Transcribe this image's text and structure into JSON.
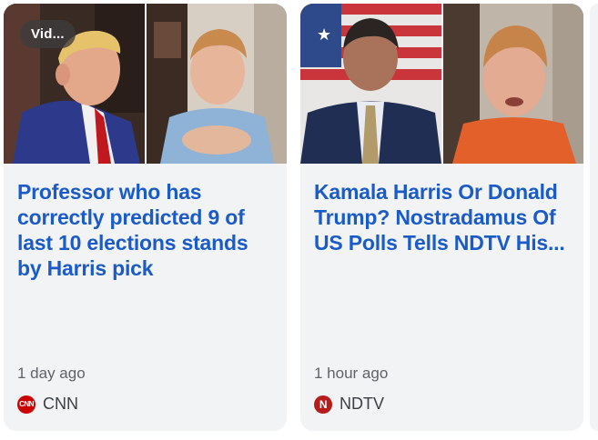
{
  "cards": [
    {
      "badge": "Vid...",
      "title": "Professor who has correctly predicted 9 of last 10 elections stands by Harris pick",
      "time": "1 day ago",
      "source": "CNN",
      "logo_text": "CNN",
      "logo_color": "#cc0000"
    },
    {
      "title": "Kamala Harris Or Donald Trump? Nostradamus Of US Polls Tells NDTV His...",
      "time": "1 hour ago",
      "source": "NDTV",
      "logo_text": "N",
      "logo_color": "#b71c1c"
    }
  ],
  "colors": {
    "card_bg": "#f1f3f5",
    "title": "#1a5bc7",
    "meta": "#5f6368"
  }
}
